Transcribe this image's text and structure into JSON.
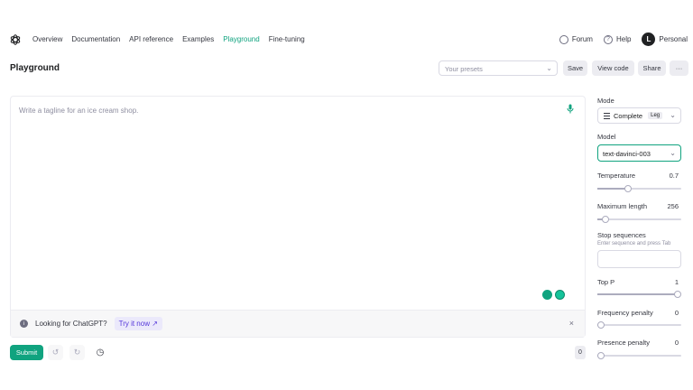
{
  "nav": {
    "links": [
      "Overview",
      "Documentation",
      "API reference",
      "Examples",
      "Playground",
      "Fine-tuning"
    ],
    "active_index": 4,
    "forum": "Forum",
    "help": "Help",
    "avatar_initial": "L",
    "personal": "Personal",
    "accent": "#10a37f"
  },
  "header": {
    "title": "Playground",
    "presets_placeholder": "Your presets",
    "save": "Save",
    "view_code": "View code",
    "share": "Share",
    "more": "···"
  },
  "editor": {
    "placeholder": "Write a tagline for an ice cream shop.",
    "banner_text": "Looking for ChatGPT?",
    "banner_link": "Try it now",
    "banner_close": "×"
  },
  "footer": {
    "submit": "Submit",
    "token_count": "0"
  },
  "settings": {
    "mode_label": "Mode",
    "mode_value": "Complete",
    "mode_badge": "Leg",
    "model_label": "Model",
    "model_value": "text-davinci-003",
    "temperature_label": "Temperature",
    "temperature_value": "0.7",
    "temperature_fraction": 0.35,
    "max_length_label": "Maximum length",
    "max_length_value": "256",
    "max_length_fraction": 0.06,
    "stop_label": "Stop sequences",
    "stop_hint": "Enter sequence and press Tab",
    "top_p_label": "Top P",
    "top_p_value": "1",
    "top_p_fraction": 1.0,
    "freq_label": "Frequency penalty",
    "freq_value": "0",
    "freq_fraction": 0.0,
    "presence_label": "Presence penalty",
    "presence_value": "0",
    "presence_fraction": 0.0
  }
}
